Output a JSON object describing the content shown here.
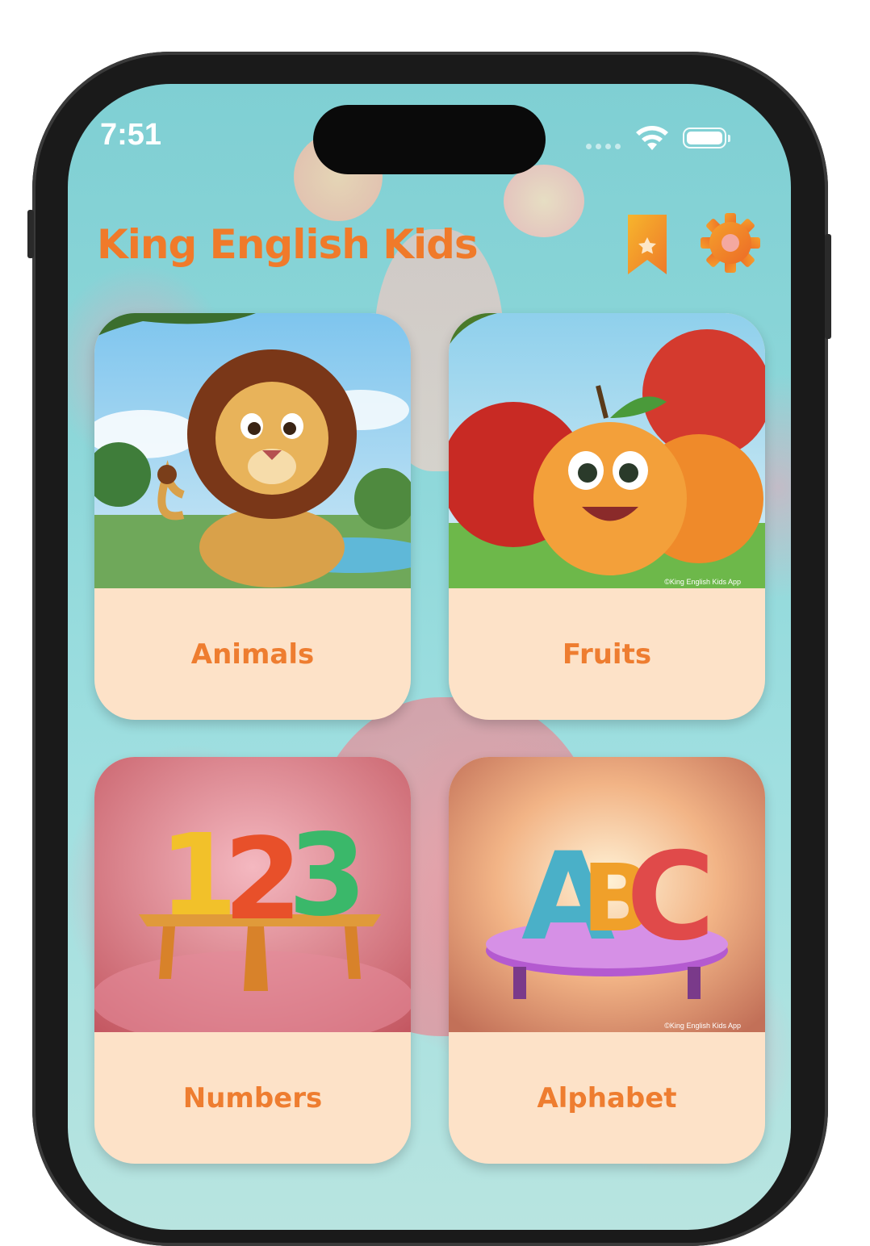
{
  "status_bar": {
    "time": "7:51"
  },
  "header": {
    "title": "King English Kids",
    "bookmark_icon": "bookmark-star-icon",
    "settings_icon": "gear-icon"
  },
  "categories": [
    {
      "label": "Animals",
      "art": "lion-illustration"
    },
    {
      "label": "Fruits",
      "art": "apple-character-illustration",
      "watermark": "©King English Kids App"
    },
    {
      "label": "Numbers",
      "art": "123-blocks-illustration"
    },
    {
      "label": "Alphabet",
      "art": "abc-letters-illustration",
      "watermark": "©King English Kids App"
    }
  ],
  "colors": {
    "accent": "#f07a2a",
    "card_bg": "#fde2c8",
    "background": "#8fd8da"
  }
}
